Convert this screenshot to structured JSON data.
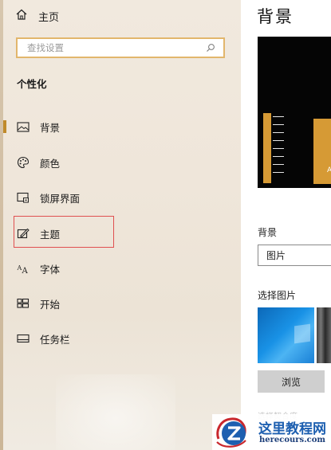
{
  "sidebar": {
    "home_label": "主页",
    "search_placeholder": "查找设置",
    "section_title": "个性化",
    "items": [
      {
        "label": "背景",
        "icon": "picture-icon",
        "active": true
      },
      {
        "label": "颜色",
        "icon": "palette-icon",
        "active": false
      },
      {
        "label": "锁屏界面",
        "icon": "lock-screen-icon",
        "active": false
      },
      {
        "label": "主题",
        "icon": "theme-brush-icon",
        "active": false,
        "highlighted": true
      },
      {
        "label": "字体",
        "icon": "font-icon",
        "active": false
      },
      {
        "label": "开始",
        "icon": "start-grid-icon",
        "active": false
      },
      {
        "label": "任务栏",
        "icon": "taskbar-icon",
        "active": false
      }
    ]
  },
  "main": {
    "page_title": "背景",
    "preview_tile_text": "A",
    "background_label": "背景",
    "background_select_value": "图片",
    "choose_picture_label": "选择图片",
    "browse_button": "浏览",
    "faded_text": "选择契合度"
  },
  "watermark": {
    "title": "这里教程网",
    "url": "herecours.com"
  },
  "colors": {
    "accent": "#c08a2b",
    "search_border": "#e2b66c",
    "highlight_box": "#e05050"
  }
}
